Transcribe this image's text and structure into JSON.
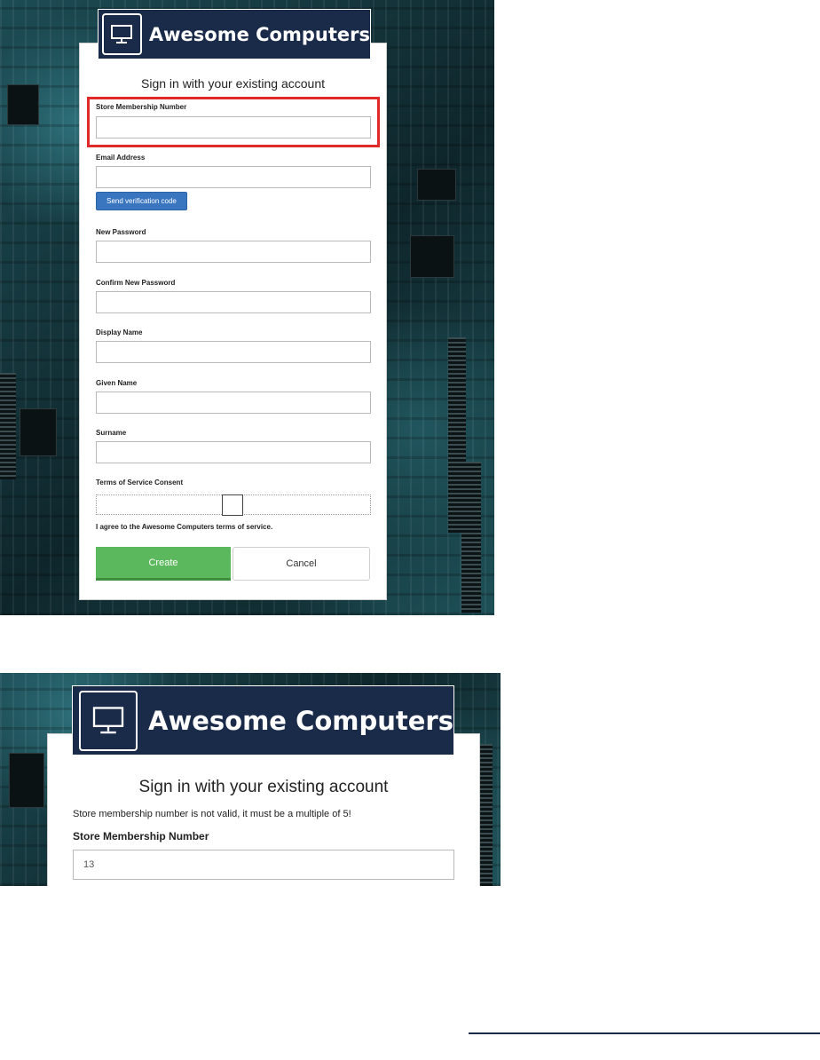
{
  "colors": {
    "brand_bg": "#1a2b4a",
    "highlight": "#e02a2a",
    "create": "#5cb85c",
    "verify": "#3a76c0"
  },
  "brand": {
    "name": "Awesome Computers",
    "icon": "monitor-icon"
  },
  "form": {
    "heading": "Sign in with your existing account",
    "membership_label": "Store Membership Number",
    "email_label": "Email Address",
    "send_code_label": "Send verification code",
    "new_password_label": "New Password",
    "confirm_password_label": "Confirm New Password",
    "display_name_label": "Display Name",
    "given_name_label": "Given Name",
    "surname_label": "Surname",
    "terms_label": "Terms of Service Consent",
    "terms_text": "I agree to the Awesome Computers terms of service.",
    "create_label": "Create",
    "cancel_label": "Cancel"
  },
  "error_view": {
    "heading": "Sign in with your existing account",
    "error_message": "Store membership number is not valid, it must be a multiple of 5!",
    "membership_label": "Store Membership Number",
    "membership_value": "13"
  }
}
